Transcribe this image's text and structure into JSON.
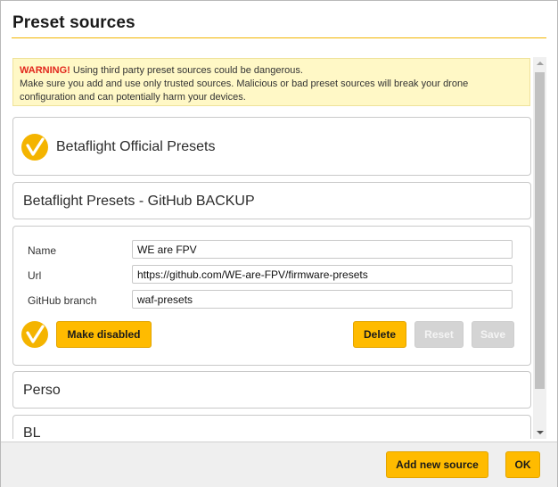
{
  "dialog": {
    "title": "Preset sources"
  },
  "warning": {
    "strong": "WARNING!",
    "line1": " Using third party preset sources could be dangerous.",
    "line2": "Make sure you add and use only trusted sources. Malicious or bad preset sources will break your drone",
    "line3": "configuration and can potentially harm your devices."
  },
  "sources": [
    {
      "name": "Betaflight Official Presets",
      "active": true
    },
    {
      "name": "Betaflight Presets - GitHub BACKUP",
      "active": false
    },
    {
      "name": "WE are FPV",
      "active": true,
      "expanded": true
    },
    {
      "name": "Perso",
      "active": false
    },
    {
      "name": "BL",
      "active": false
    }
  ],
  "editor": {
    "name_label": "Name",
    "name_value": "WE are FPV",
    "url_label": "Url",
    "url_value": "https://github.com/WE-are-FPV/firmware-presets",
    "branch_label": "GitHub branch",
    "branch_value": "waf-presets",
    "make_disabled_label": "Make disabled",
    "delete_label": "Delete",
    "reset_label": "Reset",
    "save_label": "Save"
  },
  "footer": {
    "add_new_label": "Add new source",
    "ok_label": "OK"
  },
  "colors": {
    "accent": "#ffbb00",
    "warning_bg": "#fff8c6",
    "warning_text": "#e2271c",
    "disabled_button": "#d4d4d4"
  }
}
